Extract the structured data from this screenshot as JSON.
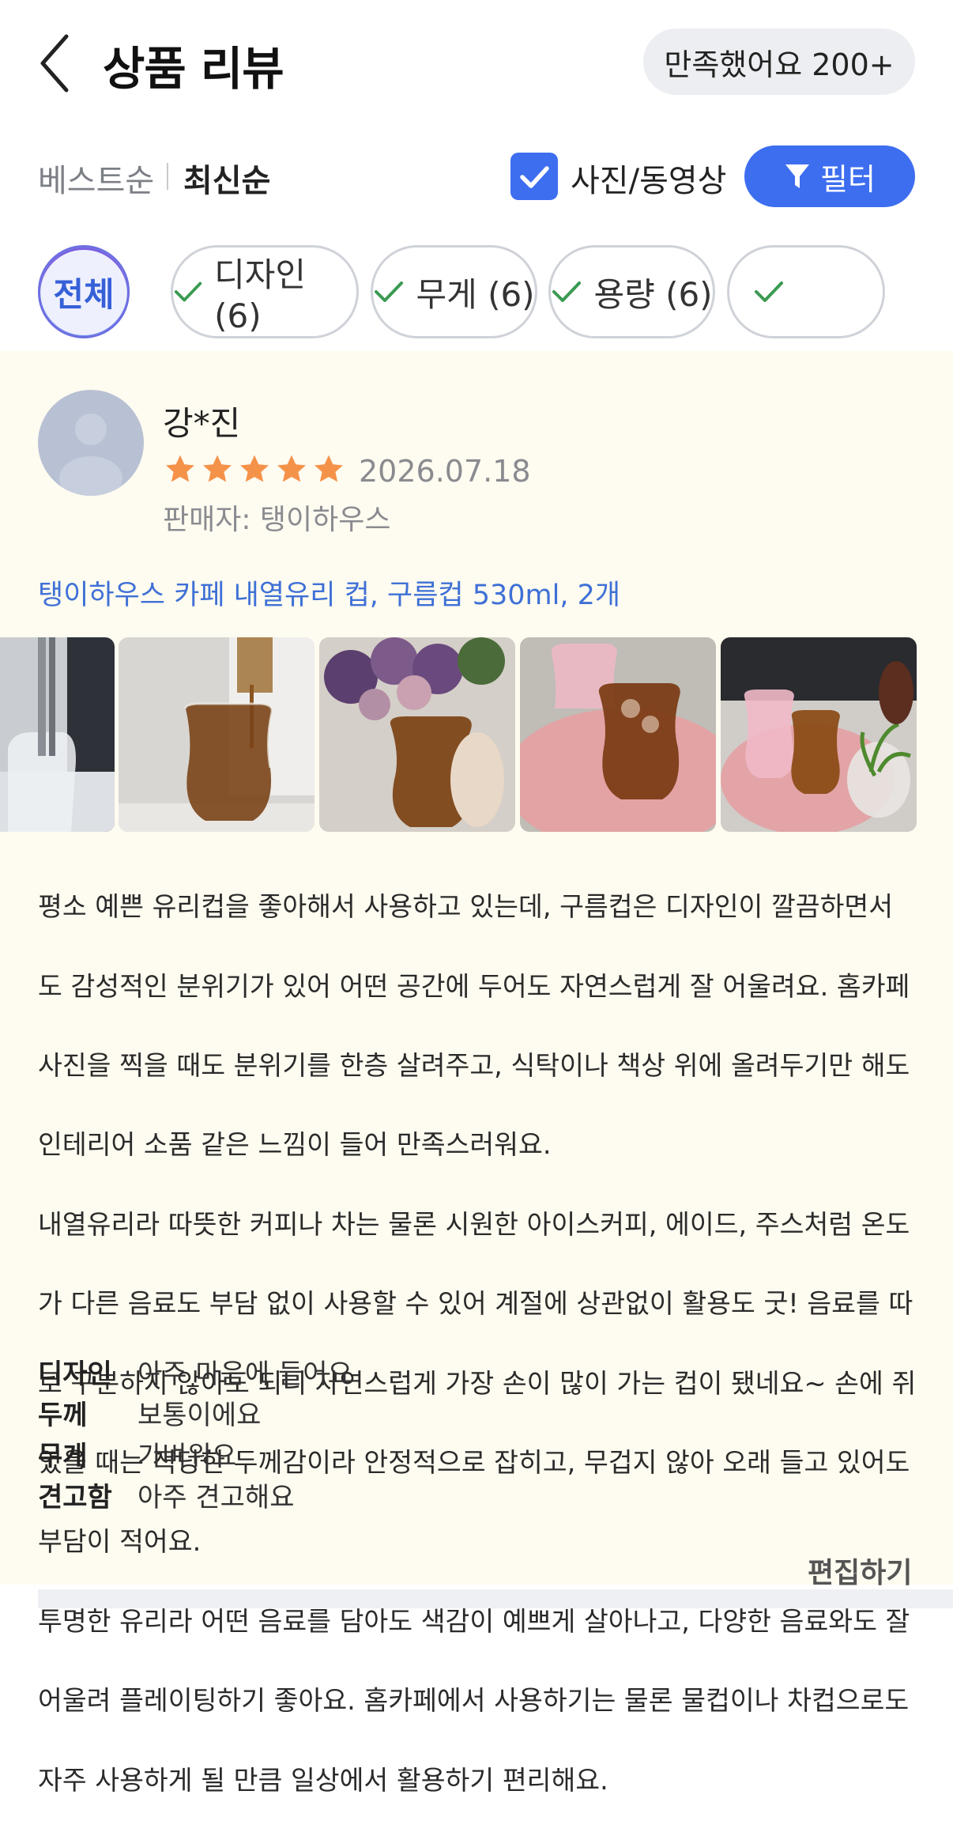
{
  "header": {
    "title": "상품 리뷰",
    "satisfaction_badge": "만족했어요 200+"
  },
  "sort": {
    "best": "베스트순",
    "newest": "최신순",
    "photo_filter_label": "사진/동영상",
    "photo_filter_checked": true,
    "filter_button": "필터"
  },
  "chips": [
    {
      "label": "전체",
      "active": true
    },
    {
      "label": "디자인 (6)",
      "active": false
    },
    {
      "label": "무게 (6)",
      "active": false
    },
    {
      "label": "용량 (6)",
      "active": false
    }
  ],
  "review": {
    "name": "강*진",
    "rating": 5,
    "date": "2026.07.18",
    "seller": "판매자: 탱이하우스",
    "product": "탱이하우스 카페 내열유리 컵, 구름컵 530ml, 2개",
    "text_lines": [
      "평소 예쁜 유리컵을 좋아해서 사용하고 있는데, 구름컵은 디자인이 깔끔하면서",
      "도 감성적인 분위기가 있어 어떤 공간에 두어도 자연스럽게 잘 어울려요. 홈카페",
      "사진을 찍을 때도 분위기를 한층 살려주고, 식탁이나 책상 위에 올려두기만 해도",
      "인테리어 소품 같은 느낌이 들어 만족스러워요.",
      "내열유리라 따뜻한 커피나 차는 물론 시원한 아이스커피, 에이드, 주스처럼 온도",
      "가 다른 음료도 부담 없이 사용할 수 있어 계절에 상관없이 활용도 굿! 음료를 따",
      "로 구분하지 않아도 되니 자연스럽게 가장 손이 많이 가는 컵이 됐네요~ 손에 쥐",
      "었을 때는 적당한 두께감이라 안정적으로 잡히고, 무겁지 않아 오래 들고 있어도",
      "부담이 적어요.",
      "투명한 유리라 어떤 음료를 담아도 색감이 예쁘게 살아나고, 다양한 음료와도 잘",
      "어울려 플레이팅하기 좋아요. 홈카페에서 사용하기는 물론 물컵이나 차컵으로도",
      "자주 사용하게 될 만큼 일상에서 활용하기 편리해요."
    ],
    "attributes": [
      {
        "key": "디자인",
        "value": "아주 마음에 들어요"
      },
      {
        "key": "두께",
        "value": "보통이에요"
      },
      {
        "key": "무게",
        "value": "가벼워요"
      },
      {
        "key": "견고함",
        "value": "아주 견고해요"
      }
    ],
    "edit_label": "편집하기"
  },
  "colors": {
    "accent": "#3d6ef0",
    "star": "#f5924a",
    "card_bg": "#fefbf0",
    "link": "#3e70d6"
  }
}
